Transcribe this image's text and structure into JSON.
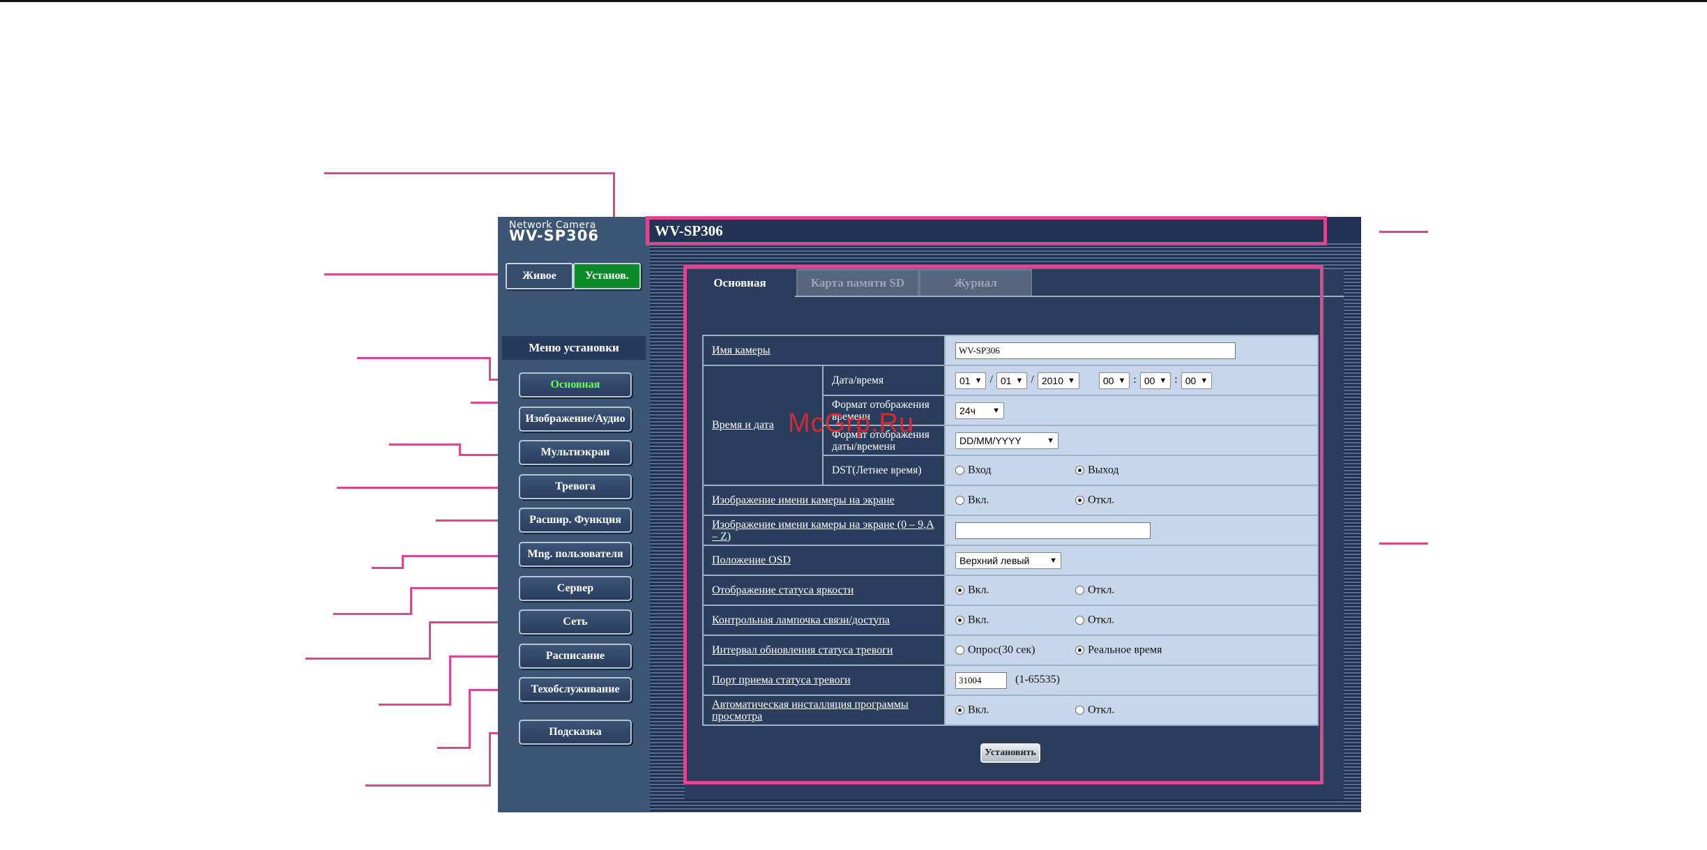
{
  "brand": {
    "small": "Network Camera",
    "model": "WV-SP306"
  },
  "title": "WV-SP306",
  "top_buttons": {
    "live": "Живое",
    "setup": "Установ."
  },
  "menu": {
    "header": "Меню установки",
    "items": [
      "Основная",
      "Изображение/Аудио",
      "Мультиэкран",
      "Тревога",
      "Расшир. Функция",
      "Mng. пользователя",
      "Сервер",
      "Сеть",
      "Расписание",
      "Техобслуживание"
    ],
    "help": "Подсказка",
    "active_index": 0
  },
  "tabs": [
    "Основная",
    "Карта памяти SD",
    "Журнал"
  ],
  "settings": {
    "camera_name": {
      "label": "Имя камеры",
      "value": "WV-SP306"
    },
    "time_date": {
      "label": "Время и дата",
      "datetime": {
        "label": "Дата/время",
        "day": "01",
        "month": "01",
        "year": "2010",
        "hour": "00",
        "minute": "00",
        "second": "00",
        "date_sep": "/",
        "time_sep": ":"
      },
      "time_format": {
        "label": "Формат отображения времени",
        "value": "24ч"
      },
      "date_format": {
        "label": "Формат отображения даты/времени",
        "value": "DD/MM/YYYY"
      },
      "dst": {
        "label": "DST(Летнее время)",
        "opt_in": "Вход",
        "opt_out": "Выход",
        "selected": "Выход"
      }
    },
    "name_display": {
      "label": "Изображение имени камеры на экране",
      "on": "Вкл.",
      "off": "Откл.",
      "selected": "Откл."
    },
    "name_text": {
      "label": "Изображение имени камеры на экране (0 – 9,A – Z)",
      "value": ""
    },
    "osd_position": {
      "label": "Положение OSD",
      "value": "Верхний левый"
    },
    "brightness_status": {
      "label": "Отображение статуса яркости",
      "on": "Вкл.",
      "off": "Откл.",
      "selected": "Вкл."
    },
    "link_lamp": {
      "label": "Контрольная лампочка связи/доступа",
      "on": "Вкл.",
      "off": "Откл.",
      "selected": "Вкл."
    },
    "alarm_interval": {
      "label": "Интервал обновления статуса тревоги",
      "opt_poll": "Опрос(30 сек)",
      "opt_realtime": "Реальное время",
      "selected": "Реальное время"
    },
    "alarm_port": {
      "label": "Порт приема статуса тревоги",
      "value": "31004",
      "range": "(1-65535)"
    },
    "auto_install": {
      "label": "Автоматическая инсталляция программы просмотра",
      "on": "Вкл.",
      "off": "Откл.",
      "selected": "Вкл."
    }
  },
  "apply_button": "Установить",
  "watermark": "McGrp.Ru",
  "colors": {
    "annotation": "#d9488f",
    "panel": "#2a3d5c",
    "value_cell": "#c7d6ea",
    "active_menu": "#6cff5a",
    "setup_button": "#0c8a2a"
  }
}
